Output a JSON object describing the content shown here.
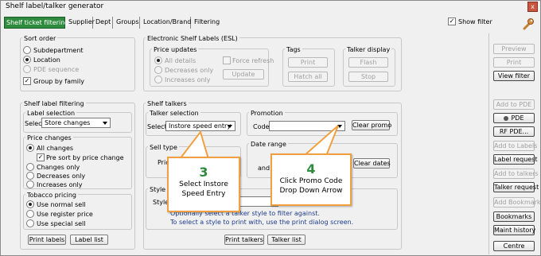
{
  "window": {
    "title": "Shelf label/talker generator",
    "close_glyph": "x"
  },
  "tabs": [
    "Shelf ticket filtering",
    "Supplier",
    "Dept",
    "Groups",
    "Location/Brand",
    "Filtering"
  ],
  "show_filter": {
    "label": "Show filter",
    "checked": true
  },
  "sort_order": {
    "title": "Sort order",
    "options": [
      "Subdepartment",
      "Location",
      "PDE sequence"
    ],
    "selected": "Location",
    "group_by_family": "Group by family"
  },
  "esl": {
    "title": "Electronic Shelf Labels (ESL)",
    "price_updates": {
      "title": "Price updates",
      "options": [
        "All details",
        "Decreases only",
        "Increases only"
      ],
      "force_refresh": "Force refresh",
      "update": "Update"
    },
    "tags": {
      "title": "Tags",
      "print": "Print",
      "hatch_all": "Hatch all"
    },
    "talker_display": {
      "title": "Talker display",
      "flash": "Flash",
      "stop": "Stop"
    }
  },
  "label_filter": {
    "title": "Shelf label filtering",
    "label_selection": {
      "title": "Label selection",
      "select_label": "Select",
      "value": "Store changes"
    },
    "price_changes": {
      "title": "Price changes",
      "all_changes": "All changes",
      "pre_sort": "Pre sort by price change",
      "changes_only": "Changes only",
      "decreases_only": "Decreases only",
      "increases_only": "Increases only"
    },
    "tobacco": {
      "title": "Tobacco pricing",
      "options": [
        "Use normal sell",
        "Use register price",
        "Use special sell"
      ]
    },
    "print_labels": "Print labels",
    "label_list": "Label list"
  },
  "talkers": {
    "title": "Shelf talkers",
    "talker_selection": {
      "title": "Talker selection",
      "select_label": "Select",
      "value": "Instore speed entry"
    },
    "promotion": {
      "title": "Promotion",
      "code_label": "Code",
      "clear_promo": "Clear promo"
    },
    "sell_type": {
      "title": "Sell type",
      "price_fragment": "Pric"
    },
    "date_range": {
      "title": "Date range",
      "and_fragment": "and",
      "clear_dates": "Clear dates"
    },
    "style": {
      "title": "Style",
      "style_label": "Style",
      "hint1": "Optionally select a talker style to filter against.",
      "hint2": "To select a style to print with, use the print dialog screen."
    },
    "print_talkers": "Print talkers",
    "talker_list": "Talker list"
  },
  "right_buttons": {
    "preview": "Preview",
    "print": "Print",
    "view_filter": "View filter",
    "add_to_pde": "Add to PDE",
    "pde": "PDE",
    "rf_pde": "RF PDE...",
    "add_to_labels": "Add to Labels",
    "label_request": "Label request",
    "add_to_talkers": "Add to talkers",
    "talker_request": "Talker request",
    "add_bookmark": "Add Bookmark",
    "bookmarks": "Bookmarks",
    "maint_history": "Maint history",
    "centre": "Centre"
  },
  "callouts": [
    {
      "number": "3",
      "line1": "Select Instore",
      "line2": "Speed Entry"
    },
    {
      "number": "4",
      "line1": "Click Promo Code",
      "line2": "Drop Down Arrow"
    }
  ],
  "colors": {
    "active_tab": "#2e8b3e",
    "callout_border": "#f0a040",
    "callout_number": "#2e8b3e"
  },
  "icons": {
    "wrench": "wrench-icon"
  }
}
